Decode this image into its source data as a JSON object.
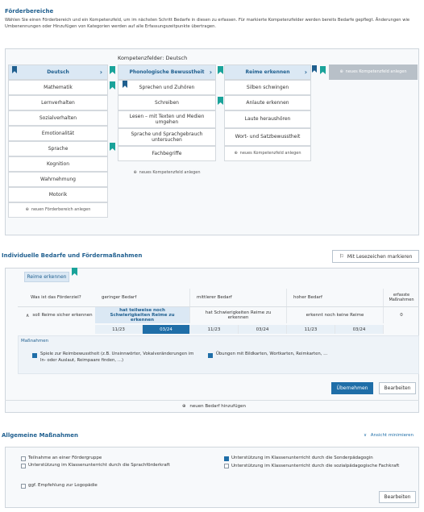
{
  "foerderbereiche": {
    "title": "Förderbereiche",
    "intro": "Wählen Sie einen Förderbereich und ein Kompetenzfeld, um im nächsten Schritt Bedarfe in diesen zu erfassen. Für markierte Kompetenzfelder werden bereits Bedarfe gepflegt. Änderungen wie Umbenennungen oder Hinzufügen von Kategorien werden auf alle Erfassungszeitpunkte übertragen.",
    "competence_caption": "Kompetenzfelder: Deutsch",
    "areas": [
      "Deutsch",
      "Mathematik",
      "Lernverhalten",
      "Sozialverhalten",
      "Emotionalität",
      "Sprache",
      "Kognition",
      "Wahrnehmung",
      "Motorik"
    ],
    "add_area": "neuen Förderbereich anlegen",
    "fields": [
      "Phonologische Bewusstheit",
      "Sprechen und Zuhören",
      "Schreiben",
      "Lesen – mit Texten und Medien umgehen",
      "Sprache und Sprachgebrauch untersuchen",
      "Fachbegriffe"
    ],
    "add_field": "neues Kompetenzfeld anlegen",
    "skills": [
      "Reime erkennen",
      "Silben schwingen",
      "Anlaute erkennen",
      "Laute heraushören",
      "Wort- und Satzbewusstheit"
    ],
    "add_skill": "neues Kompetenzfeld anlegen",
    "add_skill_right": "neues Kompetenzfeld anlegen"
  },
  "bedarfe": {
    "title": "Individuelle Bedarfe und Fördermaßnahmen",
    "bookmark_button": "Mit Lesezeichen markieren",
    "tag": "Reime erkennen",
    "col_goal": "Was ist das Förderziel?",
    "col_low": "geringer Bedarf",
    "col_mid": "mittlerer Bedarf",
    "col_high": "hoher Bedarf",
    "col_count": "erfasste Maßnahmen",
    "goal": "soll Reime sicher erkennen",
    "low_text": "hat teilweise noch Schwierigkeiten Reime zu erkennen",
    "mid_text": "hat Schwierigkeiten Reime zu erkennen",
    "high_text": "erkennt noch keine Reime",
    "count": "0",
    "dates": [
      "11/23",
      "03/24",
      "11/23",
      "03/24",
      "11/23",
      "03/24"
    ],
    "measures_label": "Maßnahmen",
    "measure1": "Spiele zur Reimbewusstheit (z.B. Unsinnwörter, Vokalveränderungen im In- oder Auslaut, Reimpaare finden, …)",
    "measure2": "Übungen mit Bildkarten, Wortkarten, Reimkarten, …",
    "apply_button": "Übernehmen",
    "edit_button": "Bearbeiten",
    "add_need": "neuen Bedarf hinzufügen"
  },
  "allgemein": {
    "title": "Allgemeine Maßnahmen",
    "minimize": "Ansicht minimieren",
    "items_left": [
      "Teilnahme an einer Fördergruppe",
      "Unterstützung im Klassenunterricht durch die Sprachförderkraft",
      "ggf. Empfehlung zur Logopädie"
    ],
    "items_right": [
      "Unterstützung im Klassenunterricht durch die Sonderpädagogin",
      "Unterstützung im Klassenunterricht durch die sozialpädagogische Fachkraft"
    ],
    "edit_button": "Bearbeiten"
  },
  "colors": {
    "accent": "#1f6ea8",
    "teal": "#1aa39a",
    "selected": "#dbe8f4"
  }
}
